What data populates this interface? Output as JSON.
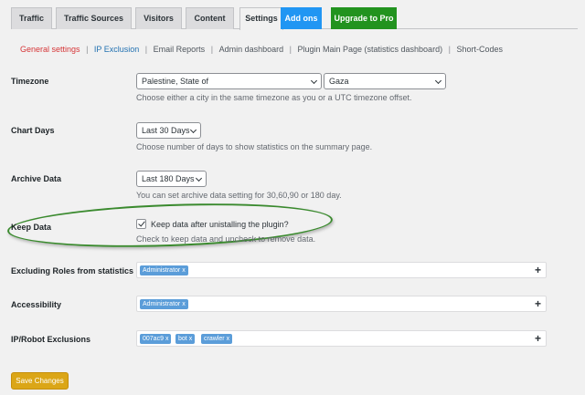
{
  "tabs": [
    {
      "label": "Traffic"
    },
    {
      "label": "Traffic Sources"
    },
    {
      "label": "Visitors"
    },
    {
      "label": "Content"
    },
    {
      "label": "Settings"
    },
    {
      "label": "Add ons"
    },
    {
      "label": "Upgrade to Pro"
    }
  ],
  "subnav": {
    "items": [
      "General settings",
      "IP Exclusion",
      "Email Reports",
      "Admin dashboard",
      "Plugin Main Page (statistics dashboard)",
      "Short-Codes"
    ],
    "separator": "|"
  },
  "timezone": {
    "label": "Timezone",
    "region_value": "Palestine, State of",
    "city_value": "Gaza",
    "description": "Choose either a city in the same timezone as you or a UTC timezone offset."
  },
  "chart_days": {
    "label": "Chart Days",
    "value": "Last 30 Days",
    "description": "Choose number of days to show statistics on the summary page."
  },
  "archive_data": {
    "label": "Archive Data",
    "value": "Last 180 Days",
    "description": "You can set archive data setting for 30,60,90 or 180 day."
  },
  "keep_data": {
    "label": "Keep Data",
    "checkbox_label": "Keep data after unistalling the plugin?",
    "checked": true,
    "description": "Check to keep data and uncheck to remove data."
  },
  "excluding_roles": {
    "label": "Excluding Roles from statistics",
    "tags": [
      "Administrator"
    ],
    "remove_symbol": "x",
    "add_symbol": "+"
  },
  "accessibility": {
    "label": "Accessibility",
    "tags": [
      "Administrator"
    ],
    "remove_symbol": "x",
    "add_symbol": "+"
  },
  "ip_exclusions": {
    "label": "IP/Robot Exclusions",
    "tags": [
      "007ac9",
      "bot",
      "crawler"
    ],
    "remove_symbol": "x",
    "add_symbol": "+"
  },
  "save_button": {
    "label": "Save Changes"
  },
  "colors": {
    "addons": "#2196f3",
    "upgrade": "#22931f",
    "current_link": "#d63638",
    "link": "#2271b1",
    "tag": "#5b9dd9",
    "save": "#dba617",
    "highlight": "#3a8a2e"
  }
}
